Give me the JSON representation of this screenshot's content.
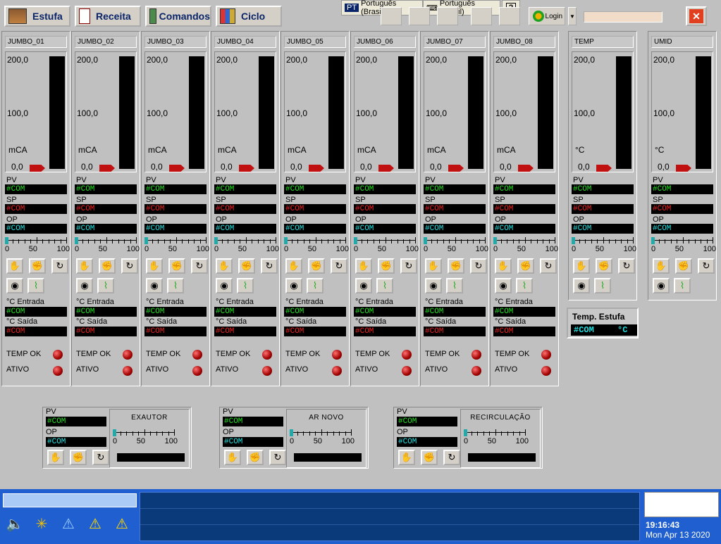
{
  "nav": {
    "estufa": "Estufa",
    "receita": "Receita",
    "comandos": "Comandos",
    "ciclo": "Ciclo"
  },
  "langbar": {
    "code": "PT",
    "lang1": "Português (Brasil)",
    "lang2": "Português (Brasil)",
    "help": "?"
  },
  "login": "Login",
  "close_symbol": "✕",
  "labels": {
    "pv": "PV",
    "sp": "SP",
    "op": "OP",
    "entrada": "°C Entrada",
    "saida": "°C Saída",
    "temp_ok": "TEMP OK",
    "ativo": "ATIVO",
    "scale0": "0",
    "scale50": "50",
    "scale100": "100",
    "com": "#COM"
  },
  "jumbo_panels": [
    {
      "title": "JUMBO_01",
      "max": "200,0",
      "mid": "100,0",
      "unit": "mCA",
      "min": "0,0"
    },
    {
      "title": "JUMBO_02",
      "max": "200,0",
      "mid": "100,0",
      "unit": "mCA",
      "min": "0,0"
    },
    {
      "title": "JUMBO_03",
      "max": "200,0",
      "mid": "100,0",
      "unit": "mCA",
      "min": "0,0"
    },
    {
      "title": "JUMBO_04",
      "max": "200,0",
      "mid": "100,0",
      "unit": "mCA",
      "min": "0,0"
    },
    {
      "title": "JUMBO_05",
      "max": "200,0",
      "mid": "100,0",
      "unit": "mCA",
      "min": "0,0"
    },
    {
      "title": "JUMBO_06",
      "max": "200,0",
      "mid": "100,0",
      "unit": "mCA",
      "min": "0,0"
    },
    {
      "title": "JUMBO_07",
      "max": "200,0",
      "mid": "100,0",
      "unit": "mCA",
      "min": "0,0"
    },
    {
      "title": "JUMBO_08",
      "max": "200,0",
      "mid": "100,0",
      "unit": "mCA",
      "min": "0,0"
    }
  ],
  "side_panels": [
    {
      "title": "TEMP",
      "max": "200,0",
      "mid": "100,0",
      "unit": "°C",
      "min": "0,0"
    },
    {
      "title": "UMID",
      "max": "200,0",
      "mid": "100,0",
      "unit": "°C",
      "min": "0,0"
    }
  ],
  "temp_estufa": {
    "title": "Temp. Estufa",
    "value": "#COM",
    "unit": "°C"
  },
  "fans": [
    {
      "name": "EXAUTOR"
    },
    {
      "name": "AR NOVO"
    },
    {
      "name": "RECIRCULAÇÃO"
    }
  ],
  "clock": {
    "time": "19:16:43",
    "date": "Mon Apr 13 2020"
  },
  "colors": {
    "com_pv": "#20e020",
    "com_sp": "#f02020",
    "com_op": "#20e0e0",
    "taskbar": "#1f5fd0",
    "led": "#c00000"
  },
  "icons": [
    "hand-icon",
    "auto-icon",
    "refresh-icon",
    "gauge-icon",
    "trend-icon",
    "speaker-icon",
    "alarm-icon"
  ]
}
